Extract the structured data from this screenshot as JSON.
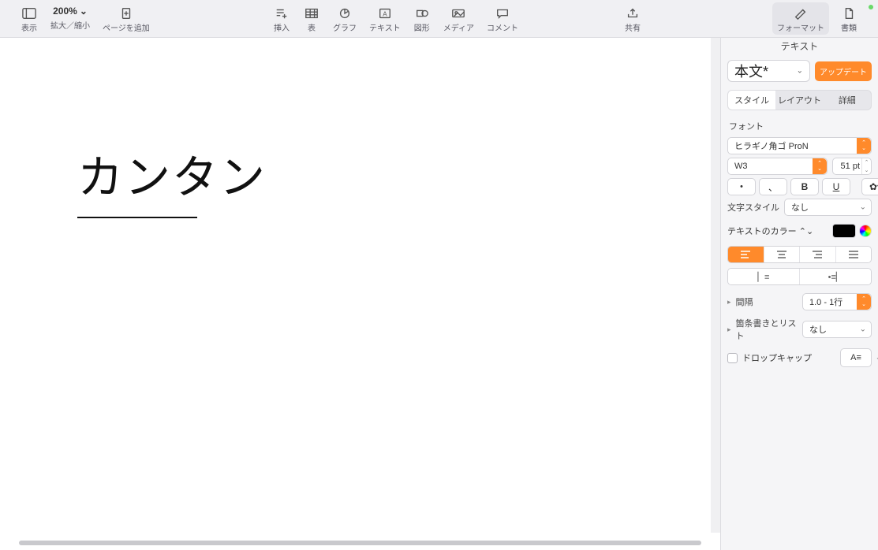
{
  "toolbar": {
    "view": "表示",
    "zoom_value": "200%",
    "zoom_label": "拡大／縮小",
    "add_page": "ページを追加",
    "insert": "挿入",
    "table": "表",
    "chart": "グラフ",
    "text": "テキスト",
    "shape": "図形",
    "media": "メディア",
    "comment": "コメント",
    "share": "共有",
    "format": "フォーマット",
    "document": "書類"
  },
  "page": {
    "text": "カンタン"
  },
  "inspector": {
    "title": "テキスト",
    "paragraph_style": "本文*",
    "update": "アップデート",
    "tabs": {
      "style": "スタイル",
      "layout": "レイアウト",
      "more": "詳細"
    },
    "font_section": "フォント",
    "font_family": "ヒラギノ角ゴ ProN",
    "font_weight": "W3",
    "font_size": "51 pt",
    "char_style_label": "文字スタイル",
    "char_style_value": "なし",
    "text_color_label": "テキストのカラー",
    "spacing_label": "間隔",
    "spacing_value": "1.0 - 1行",
    "bullets_label": "箇条書きとリスト",
    "bullets_value": "なし",
    "dropcap_label": "ドロップキャップ"
  }
}
